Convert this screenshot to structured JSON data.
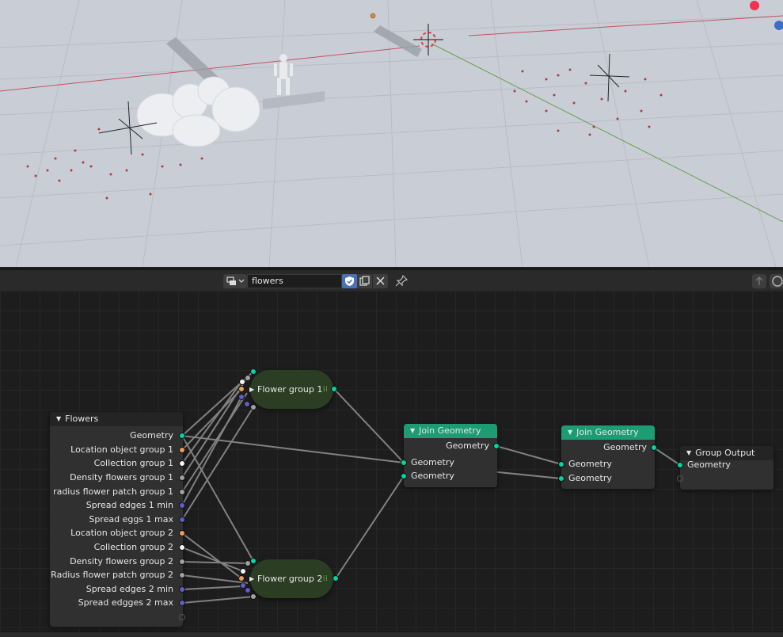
{
  "viewport": {
    "background": "#c9ced6",
    "axis_x_color": "#c4525f",
    "axis_y_color": "#6d9c4c",
    "gizmo_x_color": "#f0324b",
    "gizmo_z_color": "#3c6ec8"
  },
  "node_editor": {
    "tree_name": "flowers",
    "icons": {
      "editor_type": "node-editor-icon",
      "fake_user": "shield-icon",
      "duplicate": "duplicate-icon",
      "unlink": "close-icon",
      "pin": "pin-icon",
      "parent": "parent-arrow-icon",
      "overlay": "overlay-icon"
    },
    "colors": {
      "geometry_socket": "#00d6a3",
      "object_socket": "#ed9e5c",
      "collection_socket": "#f5f5f5",
      "float_socket": "#a1a1a1",
      "int_socket": "#5e5ec7",
      "join_header": "#1b9c73",
      "group_node": "#2b3d22"
    },
    "nodes": {
      "group_input": {
        "title": "Flowers",
        "outputs": [
          "Geometry",
          "Location object group 1",
          "Collection group 1",
          "Density flowers group 1",
          "radius flower patch group 1",
          "Spread edges 1 min",
          "Spread eggs 1 max",
          "Location object group 2",
          "Collection group 2",
          "Density flowers group 2",
          "Radius flower patch group 2",
          "Spread edges 2 min",
          "Spread edgges 2 max"
        ]
      },
      "group1": {
        "title": "Flower group 1"
      },
      "group2": {
        "title": "Flower group 2"
      },
      "join1": {
        "title": "Join Geometry",
        "output": "Geometry",
        "inputs": [
          "Geometry",
          "Geometry"
        ]
      },
      "join2": {
        "title": "Join Geometry",
        "output": "Geometry",
        "inputs": [
          "Geometry",
          "Geometry"
        ]
      },
      "group_output": {
        "title": "Group Output",
        "input": "Geometry"
      }
    }
  }
}
